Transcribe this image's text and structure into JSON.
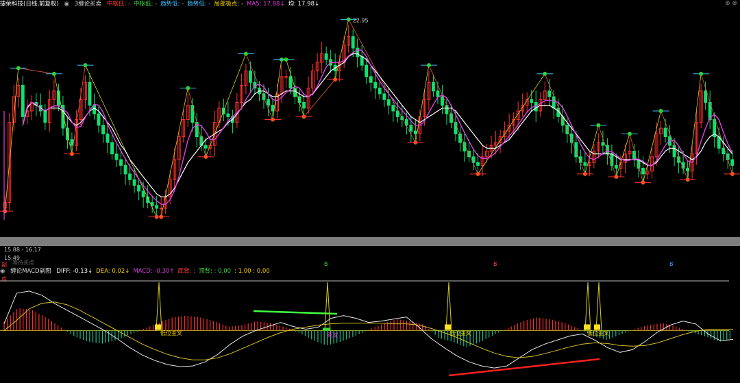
{
  "header": {
    "title": "捷荣科技(日线,前复权)",
    "indicator": "3缠论买卖",
    "items": [
      {
        "label": "中枢低:",
        "value": "-",
        "color": "#ff4040"
      },
      {
        "label": "中枢低:",
        "value": "-",
        "color": "#3fd43f"
      },
      {
        "label": "趋势低:",
        "value": "-",
        "color": "#40c0ff"
      },
      {
        "label": "趋势低:",
        "value": "-",
        "color": "#40c0ff"
      },
      {
        "label": "局部极点:",
        "value": "-",
        "color": "#ffd700"
      },
      {
        "label": "MA5:",
        "value": "17.88↓",
        "color": "#e040e0"
      },
      {
        "label": "均:",
        "value": "17.98↓",
        "color": "#ffffff"
      }
    ],
    "controls": "⊕ ⊗"
  },
  "price_axis": {
    "low_label": "15.88 - 16.17",
    "min_label": "15.49",
    "peak_label": "22.95"
  },
  "macd_header": {
    "title": "缠论MACD副图",
    "items": [
      {
        "label": "DIFF:",
        "value": "-0.13↓",
        "color": "#ffffff"
      },
      {
        "label": "DEA:",
        "value": "0.02↓",
        "color": "#ffd700"
      },
      {
        "label": "MACD:",
        "value": "-0.30↑",
        "color": "#e040e0"
      },
      {
        "label": "底背:",
        "value": ":",
        "color": "#ff4040"
      },
      {
        "label": "顶背:",
        "value": ": 0.00",
        "color": "#3fd43f"
      },
      {
        "label": "",
        "value": ": 1.00 : 0.00",
        "color": "#ffd700"
      }
    ]
  },
  "annotations": {
    "left_tag": "副",
    "wait_text": "等待买点",
    "macd_left_tag": "底",
    "golden_cross": "低位金叉",
    "golden_cross_b": "低位金叉",
    "golden_cross_c": "低位金叉",
    "dead_cross": "死叉",
    "small_markers": [
      "B",
      "B",
      "B"
    ]
  },
  "chart_data": [
    {
      "type": "candlestick",
      "title": "捷荣科技(日线,前复权)",
      "ylim": [
        15.49,
        23.2
      ],
      "close": [
        16.6,
        19.4,
        20.3,
        20.7,
        19.6,
        19.8,
        20.1,
        20.0,
        19.8,
        19.4,
        20.2,
        20.5,
        20.0,
        19.2,
        18.8,
        18.6,
        19.5,
        20.2,
        20.8,
        20.0,
        19.7,
        19.3,
        19.0,
        18.7,
        18.3,
        18.1,
        17.9,
        17.6,
        17.4,
        17.2,
        17.0,
        16.8,
        16.6,
        16.5,
        16.4,
        16.4,
        16.8,
        17.4,
        18.1,
        18.9,
        19.5,
        20.0,
        19.4,
        18.9,
        18.6,
        18.5,
        18.6,
        19.4,
        19.9,
        19.7,
        19.6,
        19.4,
        20.1,
        20.7,
        21.2,
        20.8,
        20.6,
        20.4,
        20.2,
        20.0,
        19.8,
        20.4,
        21.0,
        21.0,
        20.6,
        20.3,
        20.1,
        19.9,
        20.6,
        21.2,
        21.5,
        21.8,
        21.6,
        21.4,
        21.2,
        21.5,
        22.1,
        22.4,
        22.0,
        21.7,
        21.4,
        21.0,
        20.8,
        20.6,
        20.4,
        20.2,
        20.0,
        19.8,
        19.6,
        19.5,
        19.3,
        19.1,
        19.0,
        19.6,
        20.2,
        20.8,
        20.5,
        20.3,
        20.0,
        19.7,
        19.4,
        19.0,
        18.7,
        18.4,
        18.2,
        18.0,
        17.9,
        18.2,
        18.4,
        18.6,
        18.7,
        18.9,
        19.1,
        19.3,
        19.5,
        19.8,
        20.0,
        20.2,
        20.1,
        19.8,
        20.2,
        20.5,
        20.3,
        19.9,
        19.6,
        19.3,
        19.0,
        18.7,
        18.2,
        18.0,
        17.9,
        18.0,
        18.4,
        18.7,
        18.6,
        18.3,
        17.9,
        17.8,
        18.0,
        18.3,
        18.4,
        18.1,
        17.8,
        17.6,
        17.7,
        18.2,
        19.0,
        19.2,
        18.9,
        18.6,
        18.2,
        18.0,
        17.8,
        17.7,
        18.3,
        19.4,
        20.5,
        20.1,
        19.5,
        18.9,
        18.5,
        18.3,
        18.1,
        17.9
      ],
      "ma_white": [
        null,
        null,
        null,
        null,
        19.3,
        19.9,
        20.1,
        20.0,
        19.9,
        19.8,
        19.9,
        19.9,
        19.9,
        19.8,
        19.6,
        19.4,
        19.3,
        19.4,
        19.6,
        19.8,
        19.9,
        19.8,
        19.6,
        19.4,
        19.2,
        18.9,
        18.6,
        18.4,
        18.1,
        17.9,
        17.7,
        17.5,
        17.3,
        17.1,
        16.9,
        16.8,
        16.8,
        16.9,
        17.1,
        17.4,
        17.7,
        18.0,
        18.2,
        18.4,
        18.6,
        18.8,
        18.9,
        19.0,
        19.1,
        19.2,
        19.4,
        19.5,
        19.7,
        19.9,
        20.1,
        20.2,
        20.4,
        20.5,
        20.5,
        20.4,
        20.3,
        20.3,
        20.4,
        20.5,
        20.5,
        20.5,
        20.4,
        20.3,
        20.3,
        20.4,
        20.6,
        20.8,
        21.0,
        21.2,
        21.3,
        21.4,
        21.5,
        21.7,
        21.8,
        21.8,
        21.7,
        21.6,
        21.4,
        21.2,
        21.0,
        20.8,
        20.6,
        20.4,
        20.2,
        20.0,
        19.8,
        19.6,
        19.5,
        19.4,
        19.5,
        19.6,
        19.7,
        19.8,
        19.9,
        19.9,
        19.9,
        19.8,
        19.6,
        19.4,
        19.2,
        19.0,
        18.8,
        18.6,
        18.5,
        18.5,
        18.5,
        18.6,
        18.7,
        18.8,
        19.0,
        19.2,
        19.4,
        19.6,
        19.8,
        19.9,
        20.0,
        20.0,
        20.0,
        19.9,
        19.8,
        19.6,
        19.4,
        19.2,
        19.0,
        18.8,
        18.6,
        18.4,
        18.3,
        18.3,
        18.3,
        18.3,
        18.3,
        18.2,
        18.1,
        18.1,
        18.1,
        18.1,
        18.1,
        18.0,
        17.9,
        17.9,
        18.0,
        18.2,
        18.4,
        18.5,
        18.5,
        18.4,
        18.3,
        18.2,
        18.1,
        18.2,
        18.4,
        18.7,
        18.9,
        19.0,
        18.9,
        18.7,
        18.5,
        18.3
      ]
    },
    {
      "type": "macd",
      "title": "缠论MACD副图",
      "series": [
        {
          "name": "DIFF",
          "values": [
            0.1,
            0.55,
            0.58,
            0.52,
            0.4,
            0.3,
            0.2,
            0.1,
            0.0,
            -0.12,
            -0.25,
            -0.36,
            -0.44,
            -0.5,
            -0.53,
            -0.52,
            -0.46,
            -0.35,
            -0.2,
            -0.08,
            0.0,
            0.06,
            0.12,
            0.06,
            0.02,
            0.05,
            0.18,
            0.22,
            0.18,
            0.12,
            0.14,
            0.17,
            0.2,
            0.05,
            -0.12,
            -0.25,
            -0.37,
            -0.46,
            -0.52,
            -0.55,
            -0.52,
            -0.4,
            -0.28,
            -0.2,
            -0.14,
            -0.08,
            -0.05,
            -0.14,
            -0.25,
            -0.32,
            -0.28,
            -0.16,
            -0.02,
            0.08,
            0.14,
            0.1,
            -0.05,
            -0.15,
            -0.13
          ]
        },
        {
          "name": "DEA",
          "values": [
            0.0,
            0.15,
            0.32,
            0.4,
            0.42,
            0.38,
            0.3,
            0.2,
            0.1,
            0.0,
            -0.1,
            -0.2,
            -0.28,
            -0.35,
            -0.4,
            -0.43,
            -0.43,
            -0.4,
            -0.34,
            -0.26,
            -0.18,
            -0.1,
            -0.03,
            0.02,
            0.05,
            0.08,
            0.1,
            0.11,
            0.11,
            0.11,
            0.11,
            0.1,
            0.1,
            0.08,
            0.03,
            -0.03,
            -0.1,
            -0.18,
            -0.26,
            -0.33,
            -0.38,
            -0.4,
            -0.38,
            -0.34,
            -0.29,
            -0.24,
            -0.2,
            -0.18,
            -0.19,
            -0.22,
            -0.23,
            -0.22,
            -0.18,
            -0.12,
            -0.06,
            -0.01,
            0.02,
            0.02,
            0.02
          ]
        }
      ],
      "histogram": [
        0.25,
        0.6,
        0.55,
        0.35,
        0.1,
        -0.15,
        -0.3,
        -0.35,
        -0.25,
        -0.1,
        0.05,
        0.2,
        0.35,
        0.4,
        0.35,
        0.25,
        0.1,
        0.15,
        0.25,
        0.2,
        0.1,
        -0.05,
        -0.25,
        -0.4,
        -0.3,
        -0.15,
        0.02,
        0.18,
        0.3,
        0.25,
        0.15,
        -0.2,
        -0.3,
        -0.45,
        -0.3,
        -0.1,
        0.08,
        0.25,
        0.35,
        0.3,
        0.2,
        0.05,
        -0.15,
        -0.25,
        -0.1,
        0.05,
        0.15,
        0.2,
        0.1,
        -0.05,
        -0.15,
        -0.3,
        -0.2
      ],
      "ylim": [
        -0.7,
        0.75
      ]
    }
  ]
}
